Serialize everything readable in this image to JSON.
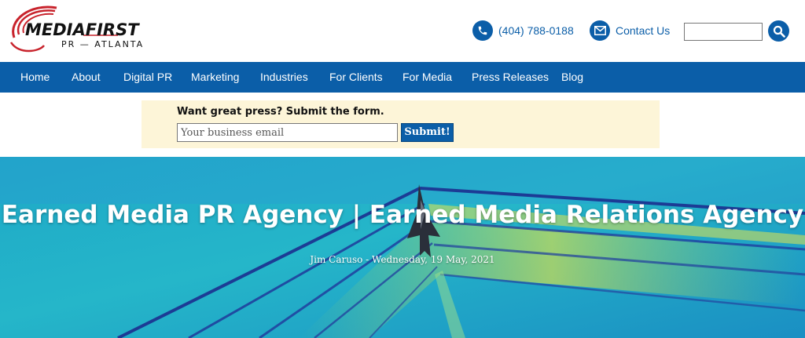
{
  "logo": {
    "brand_left": "MEDIA",
    "brand_right": "FIRST",
    "tagline": "PR — ATLANTA"
  },
  "header": {
    "phone": "(404) 788-0188",
    "contact_label": "Contact Us",
    "search_placeholder": ""
  },
  "nav": {
    "items": [
      {
        "label": "Home"
      },
      {
        "label": "About"
      },
      {
        "label": "Digital PR"
      },
      {
        "label": "Marketing"
      },
      {
        "label": "Industries"
      },
      {
        "label": "For Clients"
      },
      {
        "label": "For Media"
      },
      {
        "label": "Press Releases"
      },
      {
        "label": "Blog"
      }
    ]
  },
  "promo": {
    "title": "Want great press? Submit the form.",
    "email_placeholder": "Your business email",
    "submit_label": "Submit!"
  },
  "hero": {
    "title": "Earned Media PR Agency | Earned Media Relations Agency",
    "byline": "Jim Caruso - Wednesday, 19 May, 2021"
  },
  "colors": {
    "brand_blue": "#0b5ea8",
    "promo_bg": "#fdf5d8",
    "logo_red": "#c8232c"
  },
  "icons": {
    "phone": "phone-icon",
    "contact": "envelope-icon",
    "search": "search-icon"
  }
}
